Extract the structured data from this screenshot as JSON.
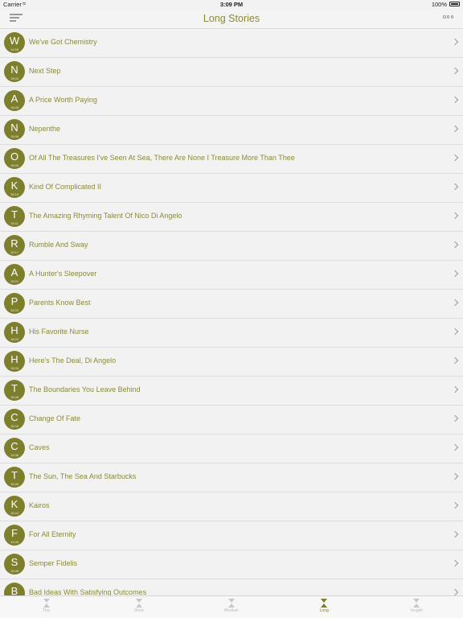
{
  "status": {
    "carrier": "Carrier",
    "time": "3:09 PM",
    "battery": "100%"
  },
  "nav": {
    "title": "Long Stories"
  },
  "stories": [
    {
      "letter": "W",
      "stamp": "14:58",
      "title": "We've Got Chemistry"
    },
    {
      "letter": "N",
      "stamp": "15:03",
      "title": "Next Step"
    },
    {
      "letter": "A",
      "stamp": "15:05",
      "title": "A Price Worth Paying"
    },
    {
      "letter": "N",
      "stamp": "15:06",
      "title": "Nepenthe"
    },
    {
      "letter": "O",
      "stamp": "15:09",
      "title": "Of All The Treasures I've Seen At Sea, There Are None I Treasure More Than Thee"
    },
    {
      "letter": "K",
      "stamp": "15:10",
      "title": "Kind Of Complicated II"
    },
    {
      "letter": "T",
      "stamp": "15:11",
      "title": "The Amazing Rhyming Talent Of Nico Di Angelo"
    },
    {
      "letter": "R",
      "stamp": "15:17",
      "title": "Rumble And Sway"
    },
    {
      "letter": "A",
      "stamp": "15:21",
      "title": "A Hunter's Sleepover"
    },
    {
      "letter": "P",
      "stamp": "15:22",
      "title": "Parents Know Best"
    },
    {
      "letter": "H",
      "stamp": "15:23",
      "title": "His Favorite Nurse"
    },
    {
      "letter": "H",
      "stamp": "15:26",
      "title": "Here's The Deal, Di Angelo"
    },
    {
      "letter": "T",
      "stamp": "15:28",
      "title": "The Boundaries You Leave Behind"
    },
    {
      "letter": "C",
      "stamp": "15:32",
      "title": "Change Of Fate"
    },
    {
      "letter": "C",
      "stamp": "15:36",
      "title": "Caves"
    },
    {
      "letter": "T",
      "stamp": "15:40",
      "title": "The Sun, The Sea And Starbucks"
    },
    {
      "letter": "K",
      "stamp": "15:44",
      "title": "Kairos"
    },
    {
      "letter": "F",
      "stamp": "15:45",
      "title": "For All Eternity"
    },
    {
      "letter": "S",
      "stamp": "15:48",
      "title": "Semper Fidelis"
    },
    {
      "letter": "B",
      "stamp": "15:50",
      "title": "Bad Ideas With Satisfying Outcomes"
    }
  ],
  "tabs": [
    {
      "label": "Tiny",
      "active": false
    },
    {
      "label": "Short",
      "active": false
    },
    {
      "label": "Medium",
      "active": false
    },
    {
      "label": "Long",
      "active": true
    },
    {
      "label": "Insight",
      "active": false
    }
  ],
  "colors": {
    "accent": "#7e7f2b",
    "text": "#8a8a3a",
    "background": "#f2f2f2"
  },
  "icons": {
    "menu": "menu-icon",
    "more": "more-icon",
    "row": "chevron-right-icon",
    "tab": "hourglass-icon"
  }
}
